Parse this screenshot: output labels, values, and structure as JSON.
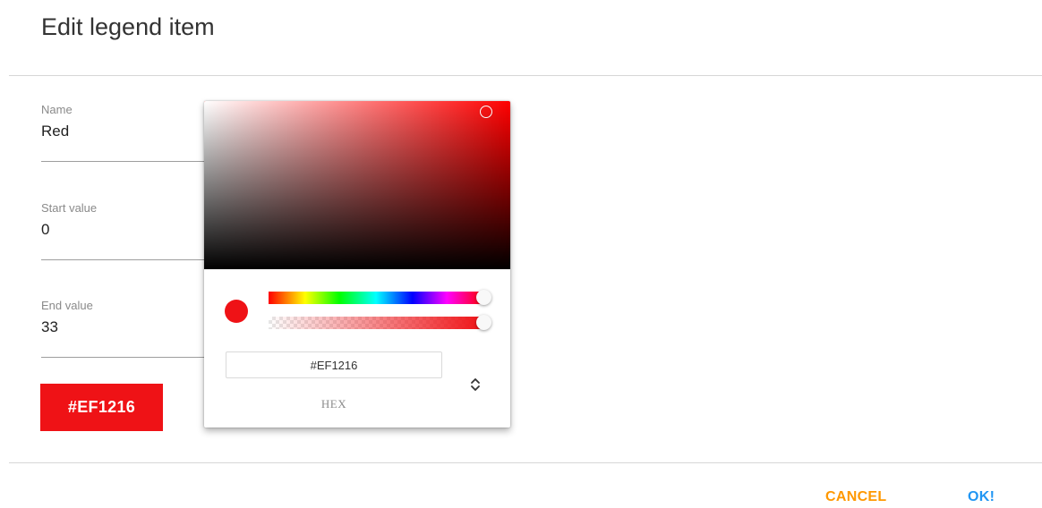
{
  "dialog": {
    "title": "Edit legend item"
  },
  "form": {
    "name_label": "Name",
    "name_value": "Red",
    "start_label": "Start value",
    "start_value": "0",
    "end_label": "End value",
    "end_value": "33"
  },
  "color_button": {
    "label": "#EF1216",
    "color": "#EF1216"
  },
  "picker": {
    "hex_value": "#EF1216",
    "mode_label": "HEX",
    "hue_level": 1.0,
    "alpha_level": 1.0,
    "swatch_color": "#EF1216",
    "mode_toggle_icon": "up-down-chevron-icon"
  },
  "actions": {
    "cancel_label": "CANCEL",
    "ok_label": "OK!",
    "cancel_color": "#FF9800",
    "ok_color": "#2196F3"
  }
}
